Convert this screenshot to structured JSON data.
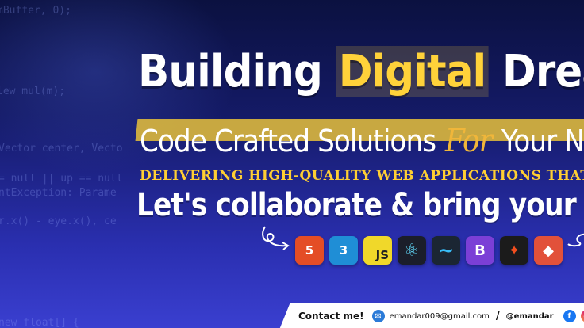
{
  "headline": {
    "part1": "Building ",
    "highlight": "Digital",
    "part2": " Dreams"
  },
  "subheadline": {
    "part1": "Code Crafted Solutions ",
    "script": "For",
    "part2": " Your Needs"
  },
  "tagline": "DELIVERING HIGH-QUALITY WEB APPLICATIONS THAT IMPRESS",
  "cta": "Let's collaborate & bring your vision",
  "tech_icons": [
    {
      "name": "html5",
      "label": "5",
      "color": "#e44d26"
    },
    {
      "name": "css3",
      "label": "3",
      "color": "#1f8ed6"
    },
    {
      "name": "javascript",
      "label": "JS",
      "color": "#f0d82a"
    },
    {
      "name": "react",
      "label": "⚛",
      "color": "#1b1e2a"
    },
    {
      "name": "tailwind",
      "label": "~",
      "color": "#1b2633"
    },
    {
      "name": "bootstrap",
      "label": "B",
      "color": "#7b3fd6"
    },
    {
      "name": "figma",
      "label": "✦",
      "color": "#1b1b1b"
    },
    {
      "name": "git",
      "label": "◆",
      "color": "#e2513a"
    }
  ],
  "contact": {
    "label": "Contact me!",
    "email": "emandar009@gmail.com",
    "separator": "/",
    "handle": "@emandar"
  },
  "code_background": [
    "mBuffer, 0);",
    "lew mul(m);",
    "Vector center, Vecto",
    "= null || up == null",
    "ntException: Parame",
    "r.x() - eye.x(), ce",
    "new float[] {"
  ]
}
